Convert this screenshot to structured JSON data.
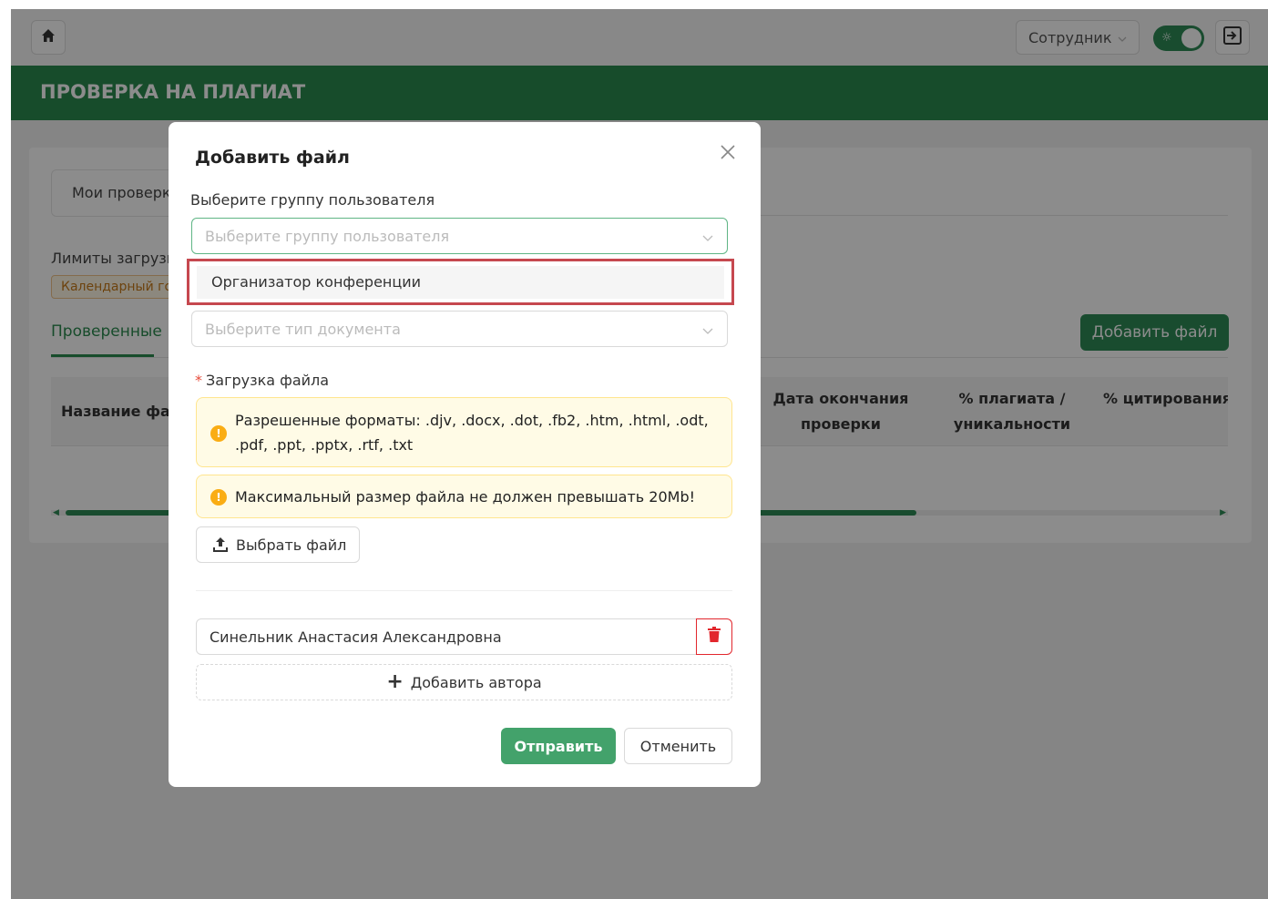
{
  "header": {
    "role_select": "Сотрудник",
    "page_title": "ПРОВЕРКА НА ПЛАГИАТ"
  },
  "background": {
    "tab_my_checks": "Мои проверки",
    "limits_label": "Лимиты загрузки",
    "calendar_badge": "Календарный год",
    "subtab_checked": "Проверенные",
    "add_file_button": "Добавить файл",
    "table_headers": {
      "name": "Название файла",
      "end_date": "Дата окончания проверки",
      "plagiarism": "% плагиата / уникальности",
      "citation": "% цитирования / самоцитирования"
    }
  },
  "modal": {
    "title": "Добавить файл",
    "group_label": "Выберите группу пользователя",
    "group_placeholder": "Выберите группу пользователя",
    "group_option": "Организатор конференции",
    "doc_type_placeholder": "Выберите тип документа",
    "upload_label": "Загрузка файла",
    "formats_alert": "Разрешенные форматы: .djv, .docx, .dot, .fb2, .htm, .html, .odt, .pdf, .ppt, .pptx, .rtf, .txt",
    "size_alert": "Максимальный размер файла не должен превышать 20Mb!",
    "choose_file": "Выбрать файл",
    "author_value": "Синельник Анастасия Александровна",
    "add_author": "Добавить автора",
    "submit": "Отправить",
    "cancel": "Отменить"
  },
  "colors": {
    "brand_green": "#2b8a4f",
    "button_green": "#43a26b",
    "warning_bg": "#fffbe6",
    "highlight_red": "#c6484f",
    "delete_red": "#e2272d"
  }
}
